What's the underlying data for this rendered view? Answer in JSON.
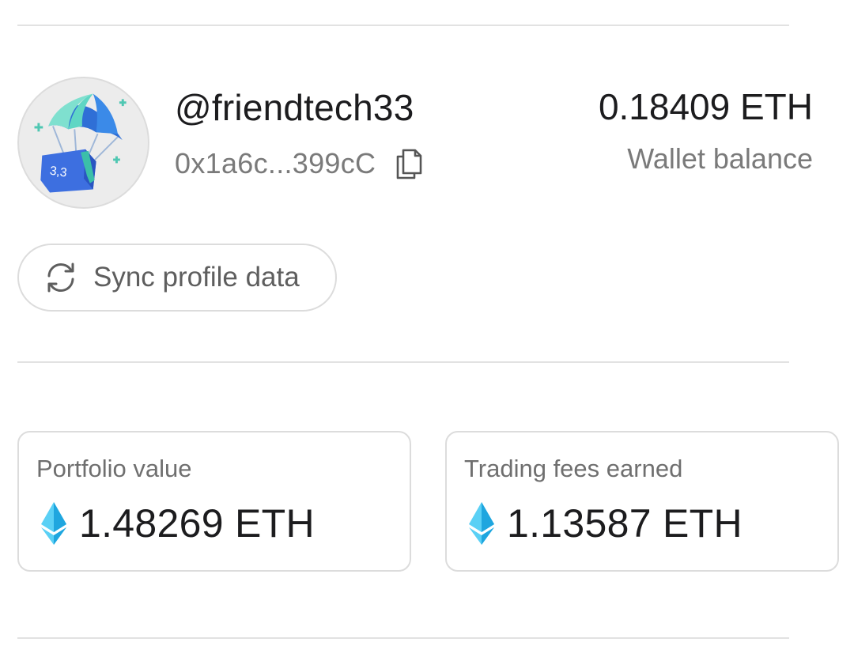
{
  "profile": {
    "username": "@friendtech33",
    "address": "0x1a6c...399cC",
    "avatar_text": "3,3"
  },
  "wallet": {
    "balance": "0.18409 ETH",
    "balance_label": "Wallet balance"
  },
  "actions": {
    "sync_label": "Sync profile data"
  },
  "stats": {
    "portfolio_label": "Portfolio value",
    "portfolio_value": "1.48269 ETH",
    "fees_label": "Trading fees earned",
    "fees_value": "1.13587 ETH"
  },
  "icons": {
    "copy": "copy-icon",
    "sync": "sync-icon",
    "eth": "ethereum-icon"
  },
  "colors": {
    "eth_light": "#5ad0f5",
    "eth_dark": "#1fa6df",
    "text_primary": "#1c1c1e",
    "text_secondary": "#7a7a7a",
    "border": "#dcdcdc"
  }
}
